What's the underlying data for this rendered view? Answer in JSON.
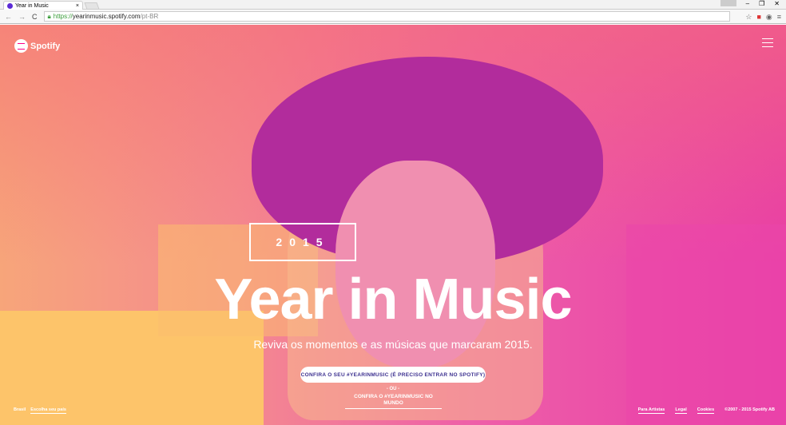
{
  "browser": {
    "tab_title": "Year in Music",
    "url_scheme": "https://",
    "url_host": "yearinmusic.spotify.com",
    "url_path": "/pt-BR"
  },
  "header": {
    "logo_text": "Spotify"
  },
  "hero": {
    "year": "2015",
    "title": "Year in Music",
    "subtitle": "Reviva os momentos e as músicas que marcaram 2015.",
    "cta_label": "CONFIRA O SEU #YEARINMUSIC (É PRECISO ENTRAR NO SPOTIFY)",
    "or_label": "- OU -",
    "world_link": "CONFIRA O #YEARINMUSIC NO MUNDO"
  },
  "footer": {
    "country": "Brasil",
    "choose_country": "Escolha seu país",
    "links": [
      "Para Artistas",
      "Legal",
      "Cookies"
    ],
    "copyright": "©2007 - 2015 Spotify AB"
  },
  "colors": {
    "peach": "#f7a57a",
    "pink": "#e83da7",
    "yellow": "#fdc46a",
    "cta_text": "#3b2f8f"
  }
}
